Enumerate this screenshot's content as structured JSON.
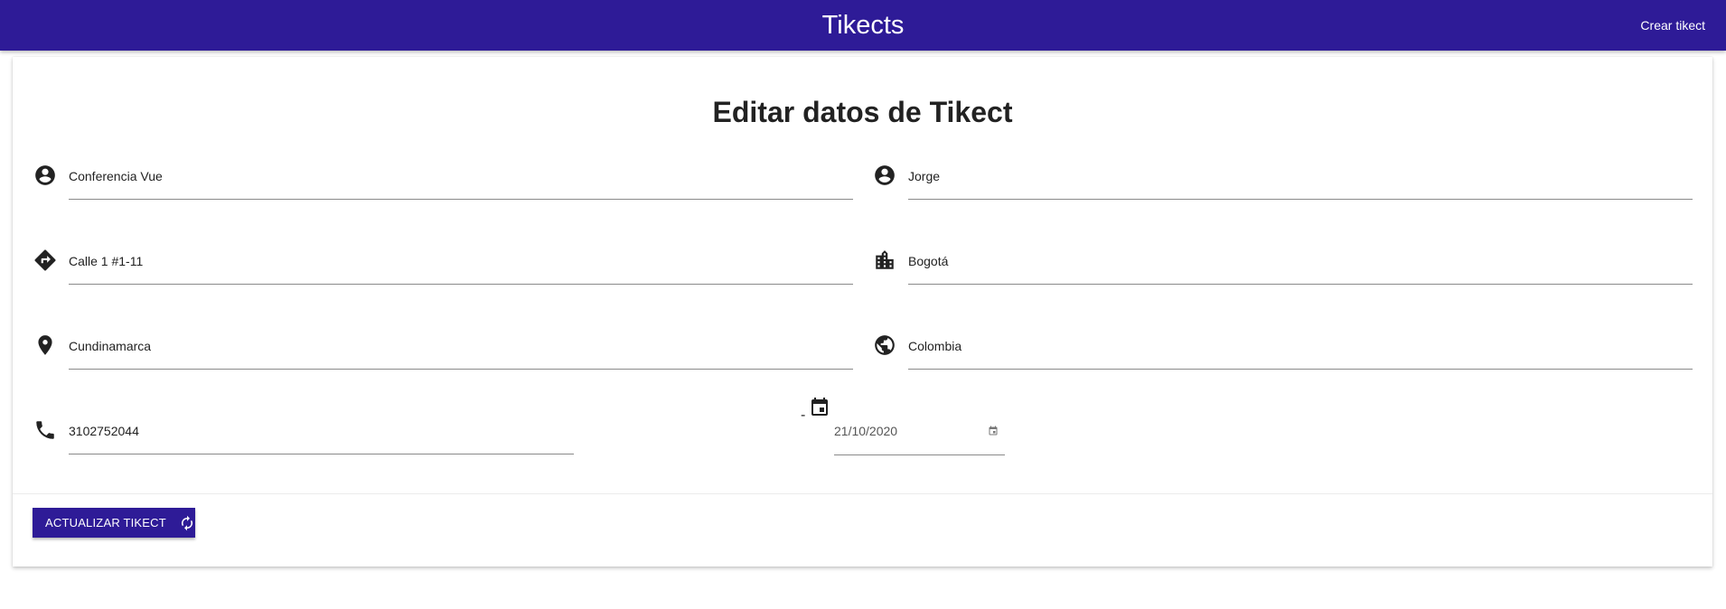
{
  "appbar": {
    "title": "Tikects",
    "create_link": "Crear tikect",
    "color": "#2e1b97"
  },
  "form": {
    "title": "Editar datos de Tikect",
    "fields": {
      "event_name": {
        "value": "Conferencia Vue",
        "icon": "account-circle-icon"
      },
      "person_name": {
        "value": "Jorge",
        "icon": "account-circle-icon"
      },
      "address": {
        "value": "Calle 1 #1-11",
        "icon": "directions-icon"
      },
      "city": {
        "value": "Bogotá",
        "icon": "city-icon"
      },
      "department": {
        "value": "Cundinamarca",
        "icon": "map-marker-icon"
      },
      "country": {
        "value": "Colombia",
        "icon": "globe-icon"
      },
      "phone": {
        "value": "3102752044",
        "icon": "phone-icon"
      },
      "date": {
        "prefix": "-",
        "value": "21/10/2020",
        "icon": "calendar-icon"
      }
    },
    "submit_button": {
      "label": "ACTUALIZAR TIKECT",
      "icon": "refresh-icon"
    }
  }
}
